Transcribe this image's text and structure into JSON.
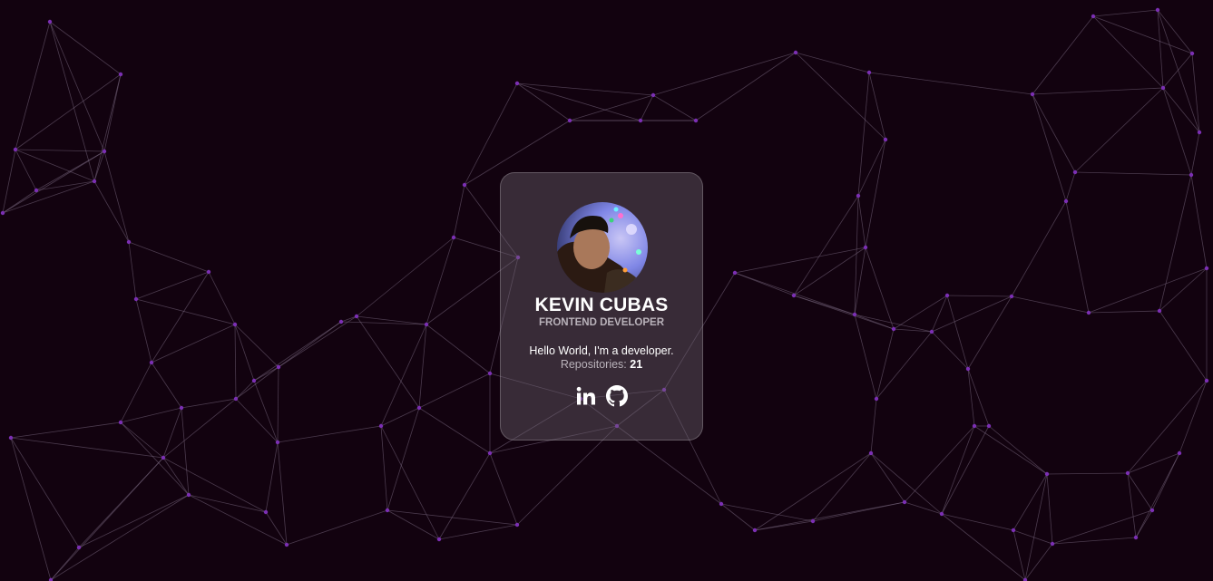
{
  "colors": {
    "background": "#12020f",
    "line": "#7a6a82",
    "node": "#7b2fb3",
    "card_background": "rgba(110,100,112,0.42)",
    "text_primary": "#ffffff",
    "text_secondary": "#b9b2ba"
  },
  "profile": {
    "name": "KEVIN CUBAS",
    "role": "FRONTEND DEVELOPER",
    "bio": "Hello World, I'm a developer.",
    "repositories_label": "Repositories:",
    "repositories_count": "21"
  },
  "socials": [
    {
      "icon": "linkedin-icon"
    },
    {
      "icon": "github-icon"
    }
  ]
}
